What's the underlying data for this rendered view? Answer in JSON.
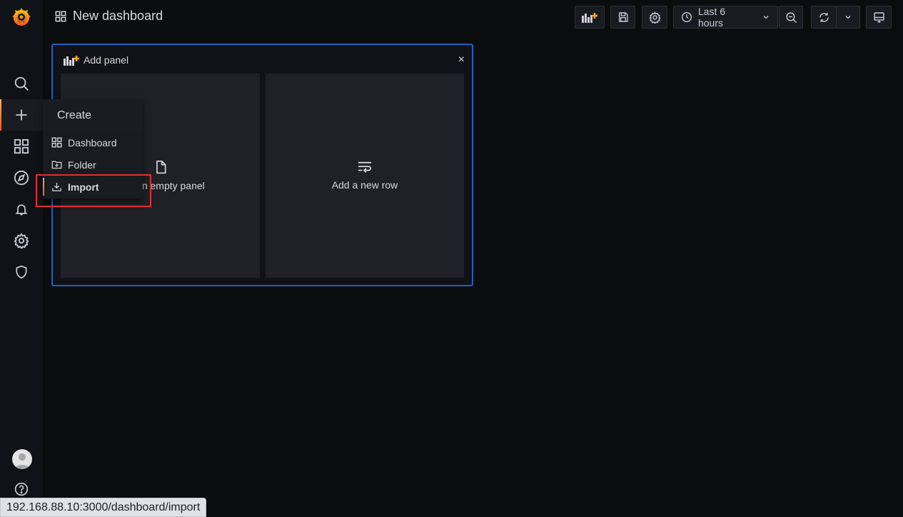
{
  "header": {
    "title": "New dashboard"
  },
  "toolbar": {
    "time_range": "Last 6 hours"
  },
  "panel": {
    "title": "Add panel",
    "close": "×",
    "options": [
      {
        "label": "Add an empty panel"
      },
      {
        "label": "Add a new row"
      }
    ]
  },
  "create_menu": {
    "header": "Create",
    "items": [
      {
        "label": "Dashboard"
      },
      {
        "label": "Folder"
      },
      {
        "label": "Import"
      }
    ]
  },
  "status_bar": {
    "url": "192.168.88.10:3000/dashboard/import"
  },
  "colors": {
    "accent": "#1f60c4",
    "highlight": "#e02f34",
    "brand_orange": "#f05a28"
  }
}
